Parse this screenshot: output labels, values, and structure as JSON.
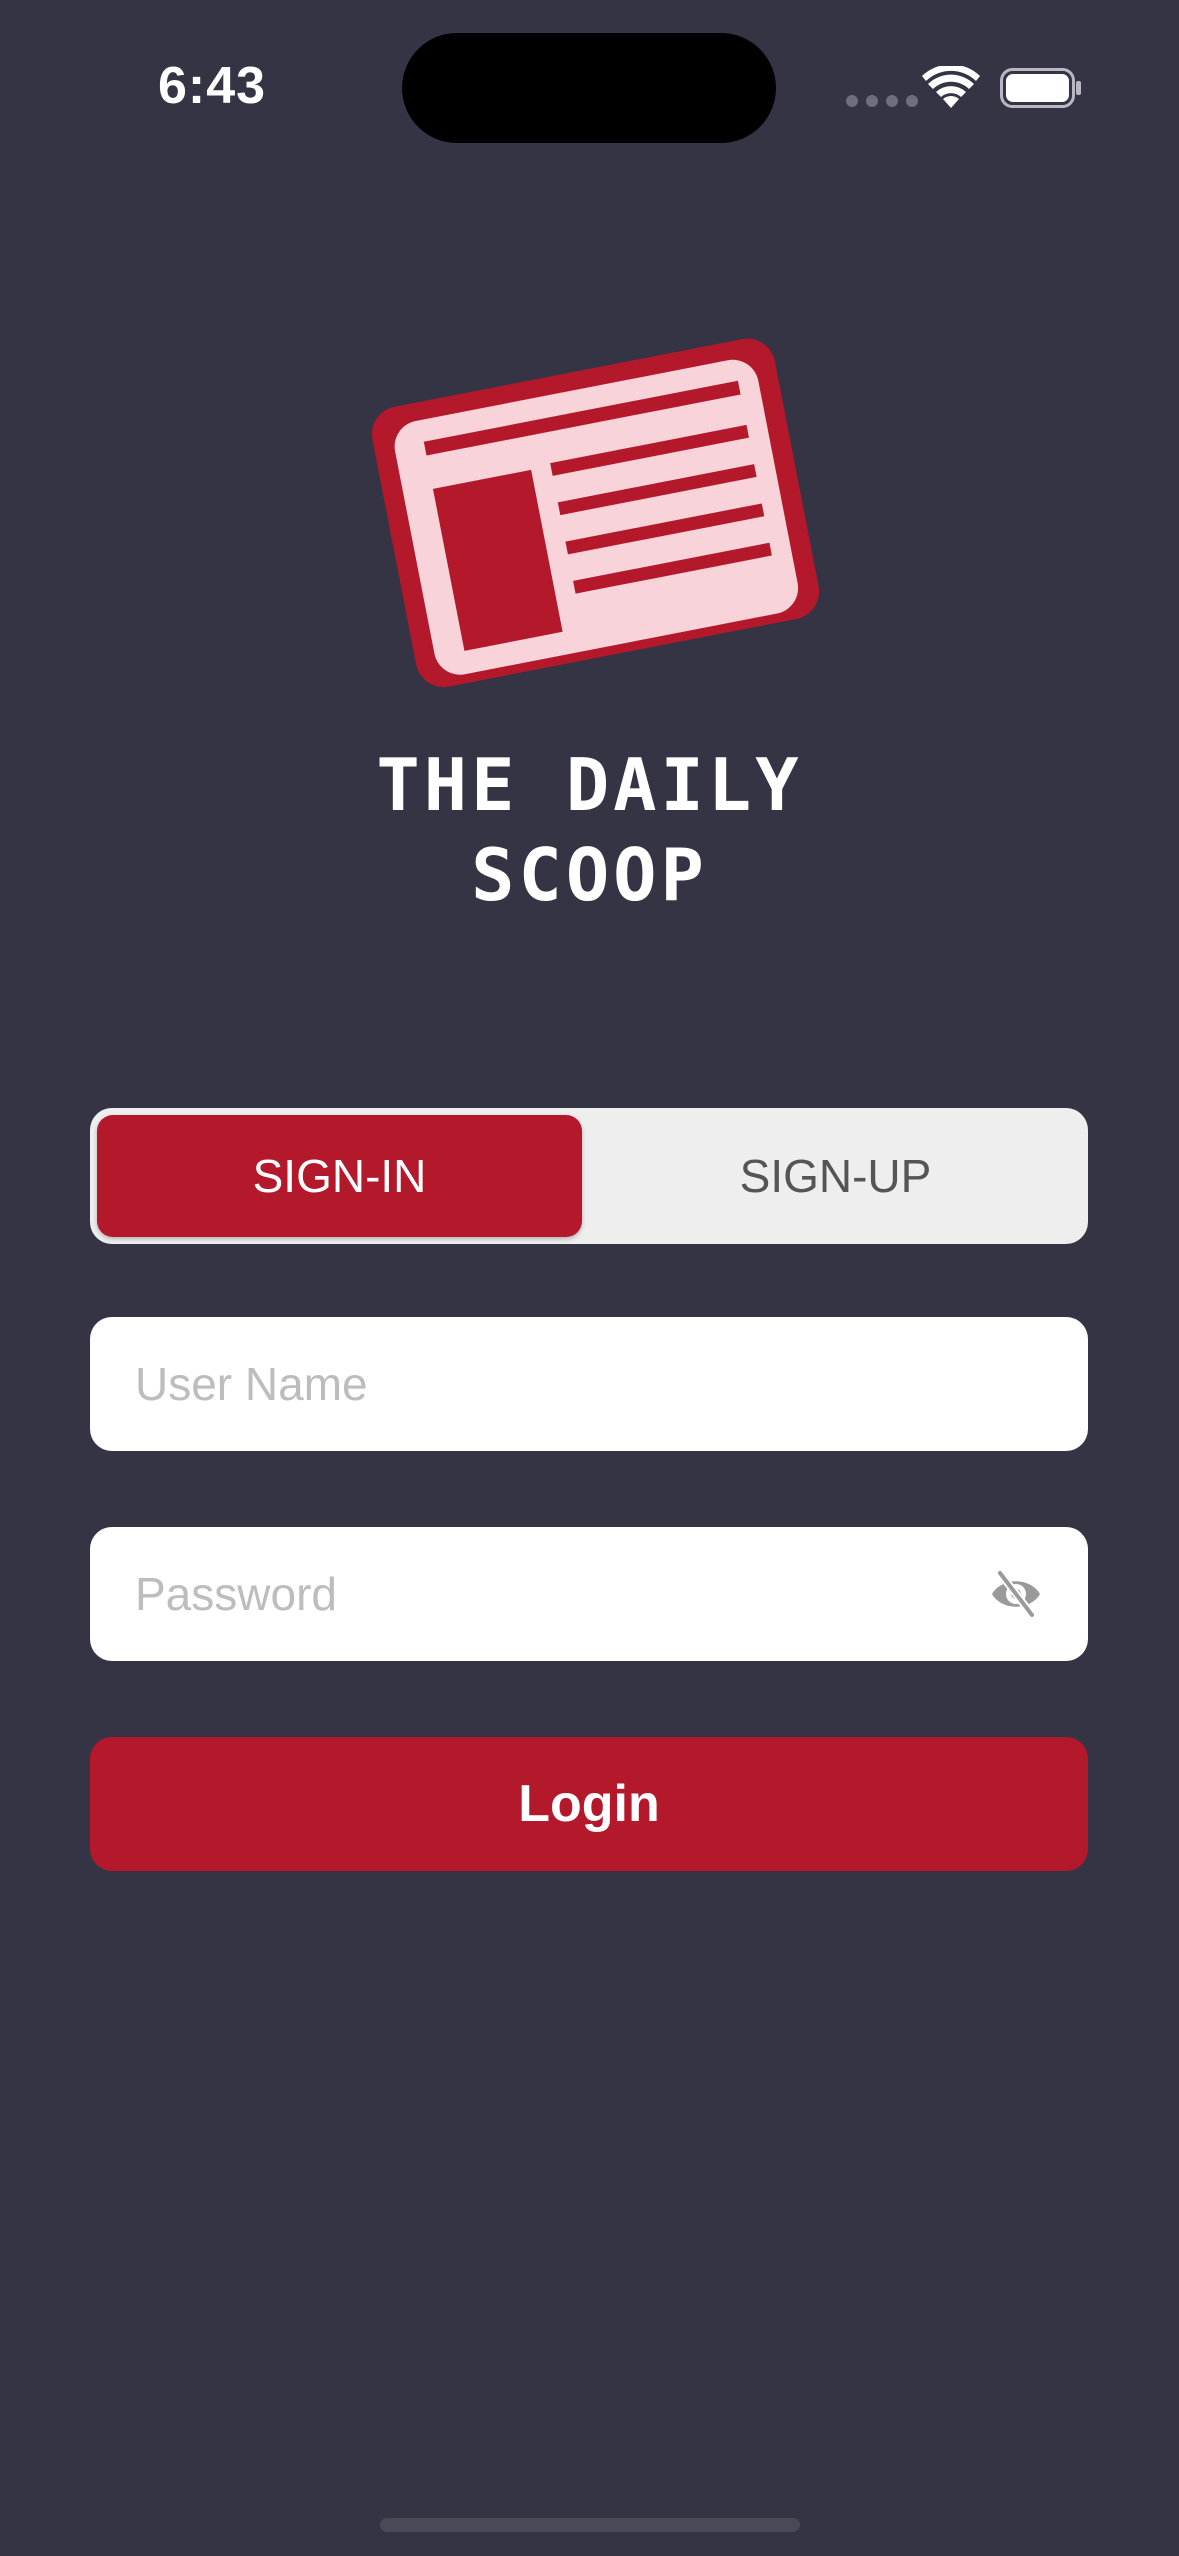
{
  "status_bar": {
    "time": "6:43"
  },
  "app": {
    "title_line1": "THE DAILY",
    "title_line2": "SCOOP",
    "logo_icon": "newspaper-icon"
  },
  "auth_tabs": {
    "signin_label": "SIGN-IN",
    "signup_label": "SIGN-UP",
    "selected": "SIGN-IN"
  },
  "form": {
    "username_placeholder": "User Name",
    "username_value": "",
    "password_placeholder": "Password",
    "password_value": "",
    "password_toggle_icon": "eye-slash-icon",
    "login_label": "Login"
  },
  "colors": {
    "background": "#353445",
    "accent": "#b3182b",
    "logo_light": "#f9d3da"
  }
}
